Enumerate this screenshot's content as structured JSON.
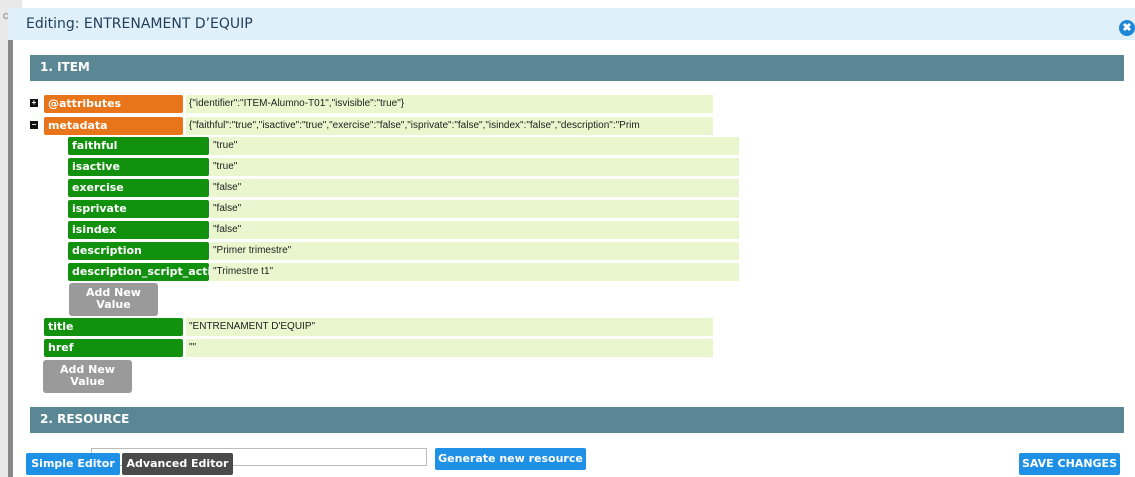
{
  "background": {
    "peek_text": "c"
  },
  "dialog": {
    "title": "Editing: ENTRENAMENT D’EQUIP",
    "close_icon": "close-icon",
    "close_glyph": "✖"
  },
  "sections": {
    "item": "1. ITEM",
    "resource": "2. RESOURCE"
  },
  "tree": {
    "expand_glyph": "+",
    "collapse_glyph": "−",
    "attributes": {
      "key": "@attributes",
      "value": "{\"identifier\":\"ITEM-Alumno-T01\",\"isvisible\":\"true\"}"
    },
    "metadata": {
      "key": "metadata",
      "value": "{\"faithful\":\"true\",\"isactive\":\"true\",\"exercise\":\"false\",\"isprivate\":\"false\",\"isindex\":\"false\",\"description\":\"Prim"
    },
    "metadata_children": [
      {
        "key": "faithful",
        "value": "\"true\""
      },
      {
        "key": "isactive",
        "value": "\"true\""
      },
      {
        "key": "exercise",
        "value": "\"false\""
      },
      {
        "key": "isprivate",
        "value": "\"false\""
      },
      {
        "key": "isindex",
        "value": "\"false\""
      },
      {
        "key": "description",
        "value": "\"Primer trimestre\""
      },
      {
        "key": "description_script_activ",
        "value": "\"Trimestre t1\""
      }
    ],
    "add_value_label_1": "Add New",
    "add_value_label_2": "Value",
    "title": {
      "key": "title",
      "value": "\"ENTRENAMENT D'EQUIP\""
    },
    "href": {
      "key": "href",
      "value": "\"\""
    }
  },
  "footer": {
    "simple_editor": "Simple Editor",
    "advanced_editor": "Advanced Editor",
    "generate_resource": "Generate new resource",
    "save_changes": "SAVE CHANGES"
  },
  "colors": {
    "header_bg": "#dff0fb",
    "section_bar": "#5b8795",
    "key_orange": "#e8751a",
    "key_green": "#12910f",
    "value_bg": "#eaf6cd",
    "button_blue": "#1e90e6",
    "button_dark": "#4a4a4a",
    "button_gray": "#9a9a9a"
  }
}
